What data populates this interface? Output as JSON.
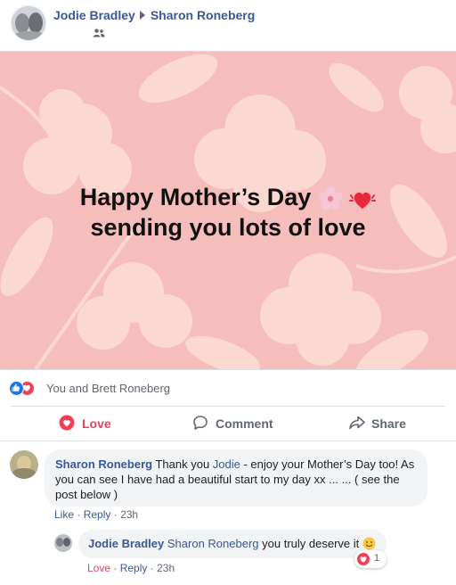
{
  "post": {
    "author": "Jodie Bradley",
    "recipient": "Sharon Roneberg",
    "audience_icon": "friends-icon",
    "card_line1": "Happy Mother’s Day",
    "card_line2": "sending you lots of love",
    "card_emojis": [
      "cherry-blossom-emoji",
      "beating-heart-emoji"
    ]
  },
  "reactions": {
    "summary": "You and Brett Roneberg",
    "icons": [
      "like-icon",
      "love-icon"
    ]
  },
  "actions": {
    "love": "Love",
    "comment": "Comment",
    "share": "Share"
  },
  "comment": {
    "author": "Sharon Roneberg",
    "text_before": "Thank you ",
    "mention": "Jodie",
    "text_after": " - enjoy your Mother’s Day too! As you can see I have had a beautiful start to my day xx ... ... ( see the post below )",
    "like": "Like",
    "reply": "Reply",
    "time": "23h",
    "sep": "·"
  },
  "reply": {
    "author": "Jodie Bradley",
    "mention": "Sharon Roneberg",
    "text": " you truly deserve it",
    "love": "Love",
    "reply": "Reply",
    "time": "23h",
    "sep": "·",
    "reaction_count": "1"
  },
  "colors": {
    "link": "#385898",
    "love": "#e4405f",
    "card_bg": "#f6bdbd"
  }
}
